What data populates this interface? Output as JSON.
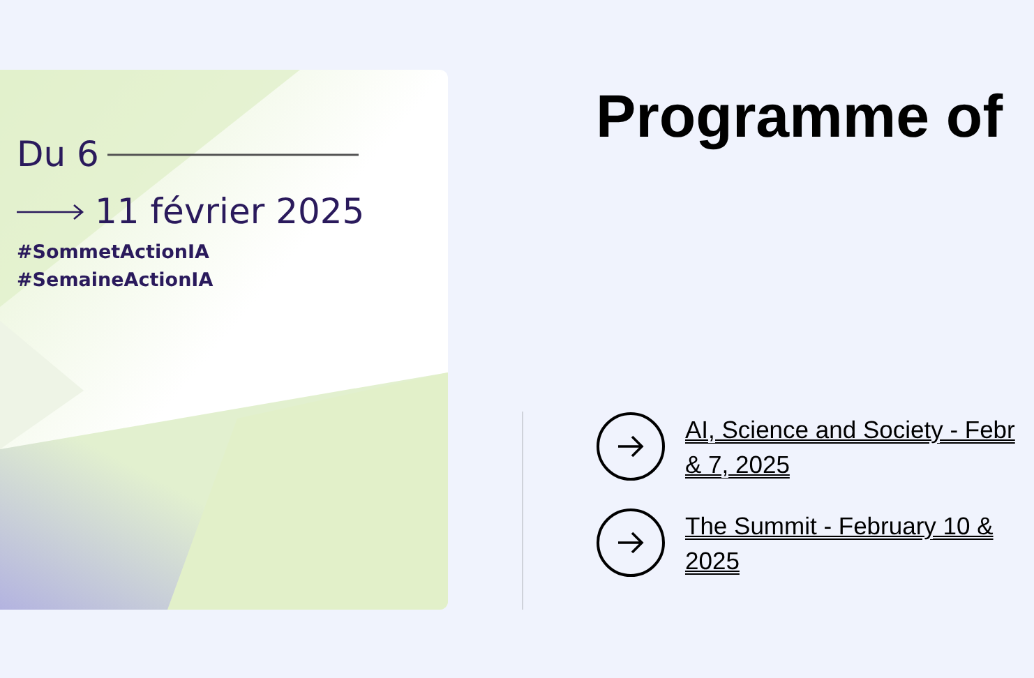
{
  "poster": {
    "date_from": "Du 6",
    "date_to": "11 février 2025",
    "hashtags": [
      "#SommetActionIA",
      "#SemaineActionIA"
    ]
  },
  "heading": "Programme of",
  "links": [
    {
      "lines": [
        "AI, Science and Society - Febr",
        "& 7, 2025"
      ]
    },
    {
      "lines": [
        "The Summit - February 10 &",
        "2025"
      ]
    }
  ]
}
